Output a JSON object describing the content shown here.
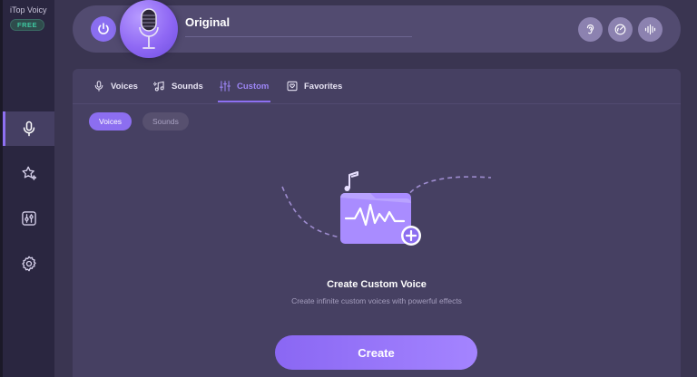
{
  "app": {
    "name": "iTop Voicy",
    "badge": "FREE"
  },
  "sidebar": {
    "items": [
      {
        "name": "voice-changer",
        "icon": "microphone-icon",
        "active": true
      },
      {
        "name": "effects",
        "icon": "sparkle-star-icon",
        "active": false
      },
      {
        "name": "mixer",
        "icon": "sliders-icon",
        "active": false
      },
      {
        "name": "settings",
        "icon": "gear-icon",
        "active": false
      }
    ]
  },
  "topbar": {
    "current_voice": "Original",
    "power_icon": "power-icon",
    "tools": [
      "ear-icon",
      "speed-gauge-icon",
      "waveform-icon"
    ]
  },
  "tabs": [
    {
      "label": "Voices",
      "icon": "microphone-icon",
      "active": false
    },
    {
      "label": "Sounds",
      "icon": "music-note-icon",
      "active": false
    },
    {
      "label": "Custom",
      "icon": "sliders-icon",
      "active": true
    },
    {
      "label": "Favorites",
      "icon": "favorites-icon",
      "active": false
    }
  ],
  "subtabs": [
    {
      "label": "Voices",
      "active": true
    },
    {
      "label": "Sounds",
      "active": false
    }
  ],
  "empty_state": {
    "title": "Create Custom Voice",
    "subtitle": "Create infinite custom voices with powerful effects",
    "button_label": "Create"
  },
  "colors": {
    "accent": "#8c6ef0",
    "background": "#3a3551",
    "panel": "#464062",
    "badge_text": "#3ec7a0"
  }
}
